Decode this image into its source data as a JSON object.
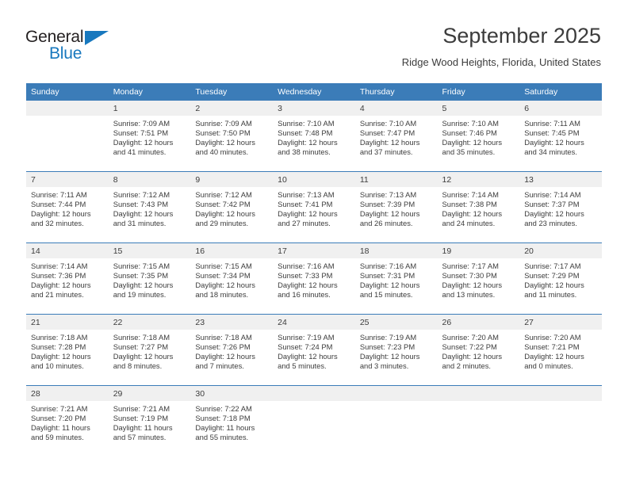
{
  "brand": {
    "name_top": "General",
    "name_bottom": "Blue",
    "accent_color": "#1878be"
  },
  "header": {
    "title": "September 2025",
    "location": "Ridge Wood Heights, Florida, United States"
  },
  "theme": {
    "header_row_bg": "#3b7cb8",
    "daynum_bg": "#f0f0f0",
    "text_color": "#3c3c3c"
  },
  "weekday_headers": [
    "Sunday",
    "Monday",
    "Tuesday",
    "Wednesday",
    "Thursday",
    "Friday",
    "Saturday"
  ],
  "weeks": [
    [
      {
        "day": "",
        "empty": true,
        "sunrise": "",
        "sunset": "",
        "daylight_line1": "",
        "daylight_line2": ""
      },
      {
        "day": "1",
        "sunrise": "Sunrise: 7:09 AM",
        "sunset": "Sunset: 7:51 PM",
        "daylight_line1": "Daylight: 12 hours",
        "daylight_line2": "and 41 minutes."
      },
      {
        "day": "2",
        "sunrise": "Sunrise: 7:09 AM",
        "sunset": "Sunset: 7:50 PM",
        "daylight_line1": "Daylight: 12 hours",
        "daylight_line2": "and 40 minutes."
      },
      {
        "day": "3",
        "sunrise": "Sunrise: 7:10 AM",
        "sunset": "Sunset: 7:48 PM",
        "daylight_line1": "Daylight: 12 hours",
        "daylight_line2": "and 38 minutes."
      },
      {
        "day": "4",
        "sunrise": "Sunrise: 7:10 AM",
        "sunset": "Sunset: 7:47 PM",
        "daylight_line1": "Daylight: 12 hours",
        "daylight_line2": "and 37 minutes."
      },
      {
        "day": "5",
        "sunrise": "Sunrise: 7:10 AM",
        "sunset": "Sunset: 7:46 PM",
        "daylight_line1": "Daylight: 12 hours",
        "daylight_line2": "and 35 minutes."
      },
      {
        "day": "6",
        "sunrise": "Sunrise: 7:11 AM",
        "sunset": "Sunset: 7:45 PM",
        "daylight_line1": "Daylight: 12 hours",
        "daylight_line2": "and 34 minutes."
      }
    ],
    [
      {
        "day": "7",
        "sunrise": "Sunrise: 7:11 AM",
        "sunset": "Sunset: 7:44 PM",
        "daylight_line1": "Daylight: 12 hours",
        "daylight_line2": "and 32 minutes."
      },
      {
        "day": "8",
        "sunrise": "Sunrise: 7:12 AM",
        "sunset": "Sunset: 7:43 PM",
        "daylight_line1": "Daylight: 12 hours",
        "daylight_line2": "and 31 minutes."
      },
      {
        "day": "9",
        "sunrise": "Sunrise: 7:12 AM",
        "sunset": "Sunset: 7:42 PM",
        "daylight_line1": "Daylight: 12 hours",
        "daylight_line2": "and 29 minutes."
      },
      {
        "day": "10",
        "sunrise": "Sunrise: 7:13 AM",
        "sunset": "Sunset: 7:41 PM",
        "daylight_line1": "Daylight: 12 hours",
        "daylight_line2": "and 27 minutes."
      },
      {
        "day": "11",
        "sunrise": "Sunrise: 7:13 AM",
        "sunset": "Sunset: 7:39 PM",
        "daylight_line1": "Daylight: 12 hours",
        "daylight_line2": "and 26 minutes."
      },
      {
        "day": "12",
        "sunrise": "Sunrise: 7:14 AM",
        "sunset": "Sunset: 7:38 PM",
        "daylight_line1": "Daylight: 12 hours",
        "daylight_line2": "and 24 minutes."
      },
      {
        "day": "13",
        "sunrise": "Sunrise: 7:14 AM",
        "sunset": "Sunset: 7:37 PM",
        "daylight_line1": "Daylight: 12 hours",
        "daylight_line2": "and 23 minutes."
      }
    ],
    [
      {
        "day": "14",
        "sunrise": "Sunrise: 7:14 AM",
        "sunset": "Sunset: 7:36 PM",
        "daylight_line1": "Daylight: 12 hours",
        "daylight_line2": "and 21 minutes."
      },
      {
        "day": "15",
        "sunrise": "Sunrise: 7:15 AM",
        "sunset": "Sunset: 7:35 PM",
        "daylight_line1": "Daylight: 12 hours",
        "daylight_line2": "and 19 minutes."
      },
      {
        "day": "16",
        "sunrise": "Sunrise: 7:15 AM",
        "sunset": "Sunset: 7:34 PM",
        "daylight_line1": "Daylight: 12 hours",
        "daylight_line2": "and 18 minutes."
      },
      {
        "day": "17",
        "sunrise": "Sunrise: 7:16 AM",
        "sunset": "Sunset: 7:33 PM",
        "daylight_line1": "Daylight: 12 hours",
        "daylight_line2": "and 16 minutes."
      },
      {
        "day": "18",
        "sunrise": "Sunrise: 7:16 AM",
        "sunset": "Sunset: 7:31 PM",
        "daylight_line1": "Daylight: 12 hours",
        "daylight_line2": "and 15 minutes."
      },
      {
        "day": "19",
        "sunrise": "Sunrise: 7:17 AM",
        "sunset": "Sunset: 7:30 PM",
        "daylight_line1": "Daylight: 12 hours",
        "daylight_line2": "and 13 minutes."
      },
      {
        "day": "20",
        "sunrise": "Sunrise: 7:17 AM",
        "sunset": "Sunset: 7:29 PM",
        "daylight_line1": "Daylight: 12 hours",
        "daylight_line2": "and 11 minutes."
      }
    ],
    [
      {
        "day": "21",
        "sunrise": "Sunrise: 7:18 AM",
        "sunset": "Sunset: 7:28 PM",
        "daylight_line1": "Daylight: 12 hours",
        "daylight_line2": "and 10 minutes."
      },
      {
        "day": "22",
        "sunrise": "Sunrise: 7:18 AM",
        "sunset": "Sunset: 7:27 PM",
        "daylight_line1": "Daylight: 12 hours",
        "daylight_line2": "and 8 minutes."
      },
      {
        "day": "23",
        "sunrise": "Sunrise: 7:18 AM",
        "sunset": "Sunset: 7:26 PM",
        "daylight_line1": "Daylight: 12 hours",
        "daylight_line2": "and 7 minutes."
      },
      {
        "day": "24",
        "sunrise": "Sunrise: 7:19 AM",
        "sunset": "Sunset: 7:24 PM",
        "daylight_line1": "Daylight: 12 hours",
        "daylight_line2": "and 5 minutes."
      },
      {
        "day": "25",
        "sunrise": "Sunrise: 7:19 AM",
        "sunset": "Sunset: 7:23 PM",
        "daylight_line1": "Daylight: 12 hours",
        "daylight_line2": "and 3 minutes."
      },
      {
        "day": "26",
        "sunrise": "Sunrise: 7:20 AM",
        "sunset": "Sunset: 7:22 PM",
        "daylight_line1": "Daylight: 12 hours",
        "daylight_line2": "and 2 minutes."
      },
      {
        "day": "27",
        "sunrise": "Sunrise: 7:20 AM",
        "sunset": "Sunset: 7:21 PM",
        "daylight_line1": "Daylight: 12 hours",
        "daylight_line2": "and 0 minutes."
      }
    ],
    [
      {
        "day": "28",
        "sunrise": "Sunrise: 7:21 AM",
        "sunset": "Sunset: 7:20 PM",
        "daylight_line1": "Daylight: 11 hours",
        "daylight_line2": "and 59 minutes."
      },
      {
        "day": "29",
        "sunrise": "Sunrise: 7:21 AM",
        "sunset": "Sunset: 7:19 PM",
        "daylight_line1": "Daylight: 11 hours",
        "daylight_line2": "and 57 minutes."
      },
      {
        "day": "30",
        "sunrise": "Sunrise: 7:22 AM",
        "sunset": "Sunset: 7:18 PM",
        "daylight_line1": "Daylight: 11 hours",
        "daylight_line2": "and 55 minutes."
      },
      {
        "day": "",
        "empty": true,
        "sunrise": "",
        "sunset": "",
        "daylight_line1": "",
        "daylight_line2": ""
      },
      {
        "day": "",
        "empty": true,
        "sunrise": "",
        "sunset": "",
        "daylight_line1": "",
        "daylight_line2": ""
      },
      {
        "day": "",
        "empty": true,
        "sunrise": "",
        "sunset": "",
        "daylight_line1": "",
        "daylight_line2": ""
      },
      {
        "day": "",
        "empty": true,
        "sunrise": "",
        "sunset": "",
        "daylight_line1": "",
        "daylight_line2": ""
      }
    ]
  ]
}
